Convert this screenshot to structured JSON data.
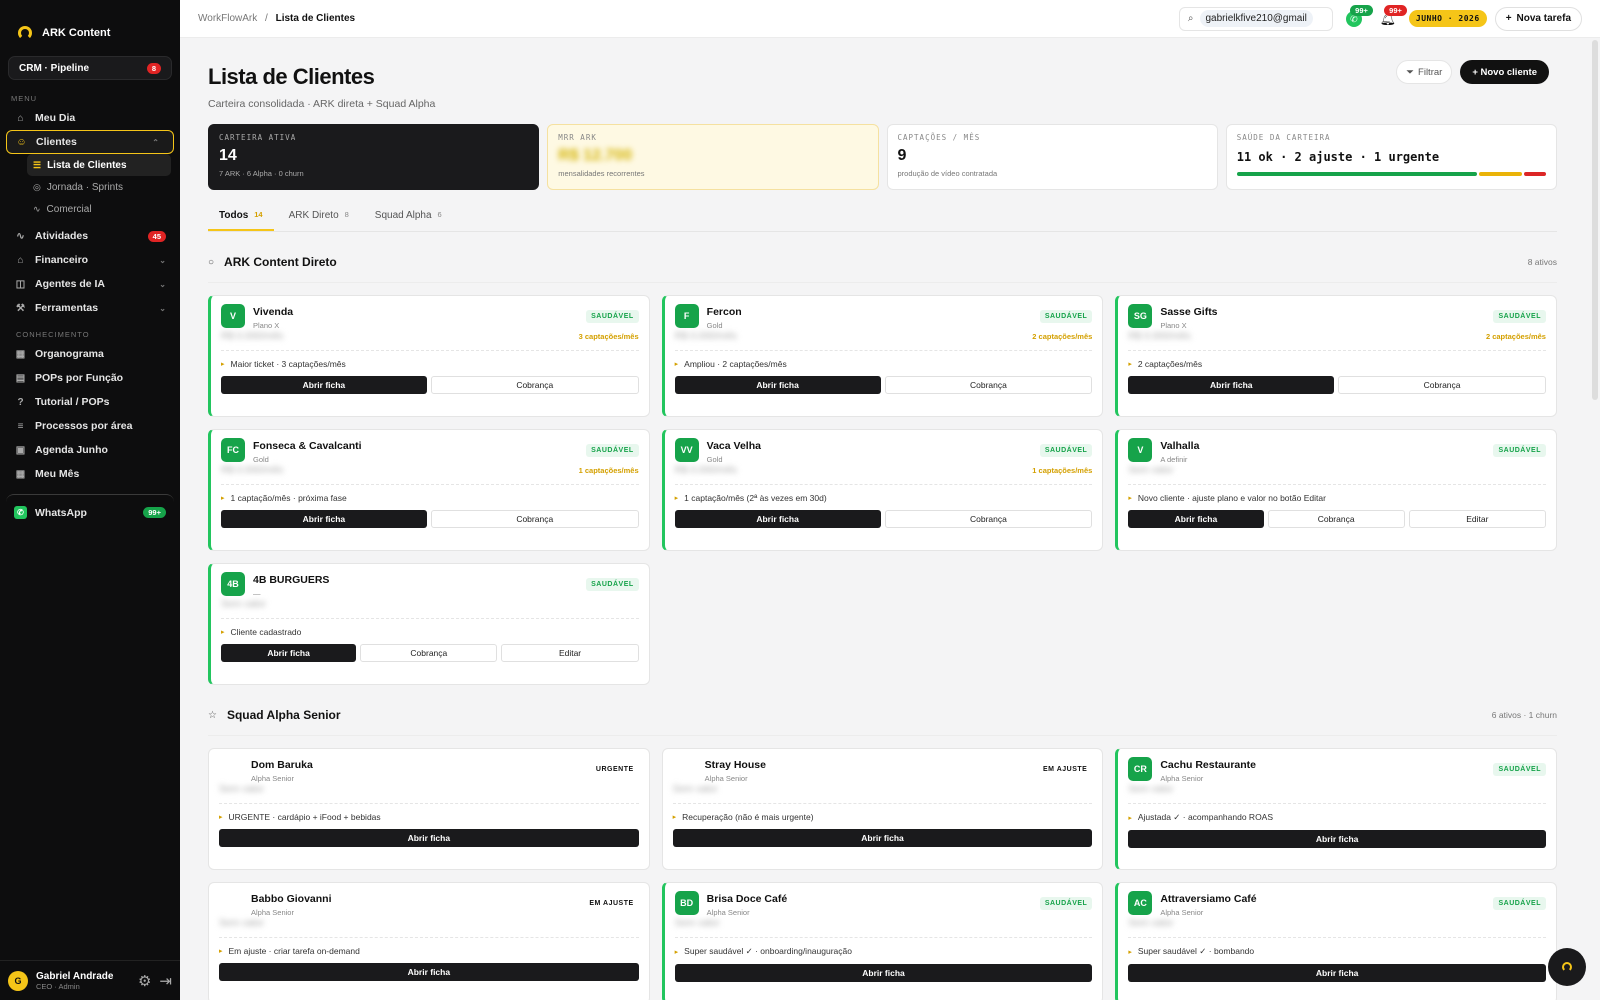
{
  "app": {
    "name": "ARK Content"
  },
  "sidebar": {
    "crm": {
      "label": "CRM · Pipeline",
      "badge": "8"
    },
    "menu_label": "MENU",
    "meu_dia": "Meu Dia",
    "clientes": "Clientes",
    "sub": [
      "Lista de Clientes",
      "Jornada · Sprints",
      "Comercial"
    ],
    "atividades": {
      "label": "Atividades",
      "badge": "45"
    },
    "financeiro": "Financeiro",
    "agentes": "Agentes de IA",
    "ferramentas": "Ferramentas",
    "conhecimento_label": "CONHECIMENTO",
    "conhecimento": [
      "Organograma",
      "POPs por Função",
      "Tutorial / POPs",
      "Processos por área",
      "Agenda Junho",
      "Meu Mês"
    ],
    "whatsapp": {
      "label": "WhatsApp",
      "badge": "99+"
    },
    "user": {
      "initial": "G",
      "name": "Gabriel Andrade",
      "role": "CEO · Admin"
    }
  },
  "topbar": {
    "crumb_root": "WorkFlowArk",
    "crumb_sep": "/",
    "crumb_current": "Lista de Clientes",
    "search_value": "gabrielkfive210@gmail",
    "wa_badge": "99+",
    "bell_badge": "99+",
    "month": "JUNHO · 2026",
    "new_task": "Nova tarefa"
  },
  "page": {
    "title": "Lista de Clientes",
    "subtitle": "Carteira consolidada · ARK direta + Squad Alpha",
    "filter": "Filtrar",
    "new_client": "+ Novo cliente"
  },
  "kpis": {
    "k1": {
      "label": "CARTEIRA ATIVA",
      "value": "14",
      "note": "7 ARK · 6 Alpha · 0 churn"
    },
    "k2": {
      "label": "MRR ARK",
      "value": "R$ 12.700",
      "note": "mensalidades recorrentes"
    },
    "k3": {
      "label": "CAPTAÇÕES / MÊS",
      "value": "9",
      "note": "produção de vídeo contratada"
    },
    "k4": {
      "label": "SAÚDE DA CARTEIRA",
      "value": "11 ok · 2 ajuste · 1 urgente",
      "health": {
        "ok": 11,
        "ajuste": 2,
        "urgente": 1
      }
    }
  },
  "tabs": [
    {
      "label": "Todos",
      "count": "14"
    },
    {
      "label": "ARK Direto",
      "count": "8"
    },
    {
      "label": "Squad Alpha",
      "count": "6"
    }
  ],
  "sections": {
    "ark": {
      "name": "ARK Content Direto",
      "meta": "8 ativos"
    },
    "alpha": {
      "name": "Squad Alpha Senior",
      "meta": "6 ativos · 1 churn"
    }
  },
  "buttons": {
    "open": "Abrir ficha",
    "bill": "Cobrança",
    "edit": "Editar"
  },
  "ark_clients": [
    {
      "initials": "V",
      "name": "Vivenda",
      "plan": "Plano X",
      "status": "SAUDÁVEL",
      "money": "R$ 0.000/mês",
      "capt": "3 captações/mês",
      "note": "Maior ticket · 3 captações/mês"
    },
    {
      "initials": "F",
      "name": "Fercon",
      "plan": "Gold",
      "status": "SAUDÁVEL",
      "money": "R$ 0.000/mês",
      "capt": "2 captações/mês",
      "note": "Ampliou · 2 captações/mês"
    },
    {
      "initials": "SG",
      "name": "Sasse Gifts",
      "plan": "Plano X",
      "status": "SAUDÁVEL",
      "money": "R$ 0.000/mês",
      "capt": "2 captações/mês",
      "note": "2 captações/mês"
    },
    {
      "initials": "FC",
      "name": "Fonseca & Cavalcanti",
      "plan": "Gold",
      "status": "SAUDÁVEL",
      "money": "R$ 0.000/mês",
      "capt": "1 captações/mês",
      "note": "1 captação/mês · próxima fase"
    },
    {
      "initials": "VV",
      "name": "Vaca Velha",
      "plan": "Gold",
      "status": "SAUDÁVEL",
      "money": "R$ 0.000/mês",
      "capt": "1 captações/mês",
      "note": "1 captação/mês (2ª às vezes em 30d)"
    },
    {
      "initials": "V",
      "name": "Valhalla",
      "plan": "A definir",
      "status": "SAUDÁVEL",
      "money": "Sem valor",
      "capt": "",
      "note": "Novo cliente · ajuste plano e valor no botão Editar"
    },
    {
      "initials": "4B",
      "name": "4B BURGUERS",
      "plan": "—",
      "status": "SAUDÁVEL",
      "money": "Sem valor",
      "capt": "",
      "note": "Cliente cadastrado"
    }
  ],
  "alpha_clients": [
    {
      "initials": "",
      "name": "Dom Baruka",
      "plan": "Alpha Senior",
      "status": "URGENTE",
      "money": "Sem valor",
      "note": "URGENTE · cardápio + iFood + bebidas"
    },
    {
      "initials": "",
      "name": "Stray House",
      "plan": "Alpha Senior",
      "status": "EM AJUSTE",
      "money": "Sem valor",
      "note": "Recuperação (não é mais urgente)"
    },
    {
      "initials": "CR",
      "name": "Cachu Restaurante",
      "plan": "Alpha Senior",
      "status": "SAUDÁVEL",
      "money": "Sem valor",
      "note": "Ajustada ✓ · acompanhando ROAS"
    },
    {
      "initials": "",
      "name": "Babbo Giovanni",
      "plan": "Alpha Senior",
      "status": "EM AJUSTE",
      "money": "Sem valor",
      "note": "Em ajuste · criar tarefa on-demand"
    },
    {
      "initials": "BD",
      "name": "Brisa Doce Café",
      "plan": "Alpha Senior",
      "status": "SAUDÁVEL",
      "money": "Sem valor",
      "note": "Super saudável ✓ · onboarding/inauguração"
    },
    {
      "initials": "AC",
      "name": "Attraversiamo Café",
      "plan": "Alpha Senior",
      "status": "SAUDÁVEL",
      "money": "Sem valor",
      "note": "Super saudável ✓ · bombando"
    }
  ]
}
